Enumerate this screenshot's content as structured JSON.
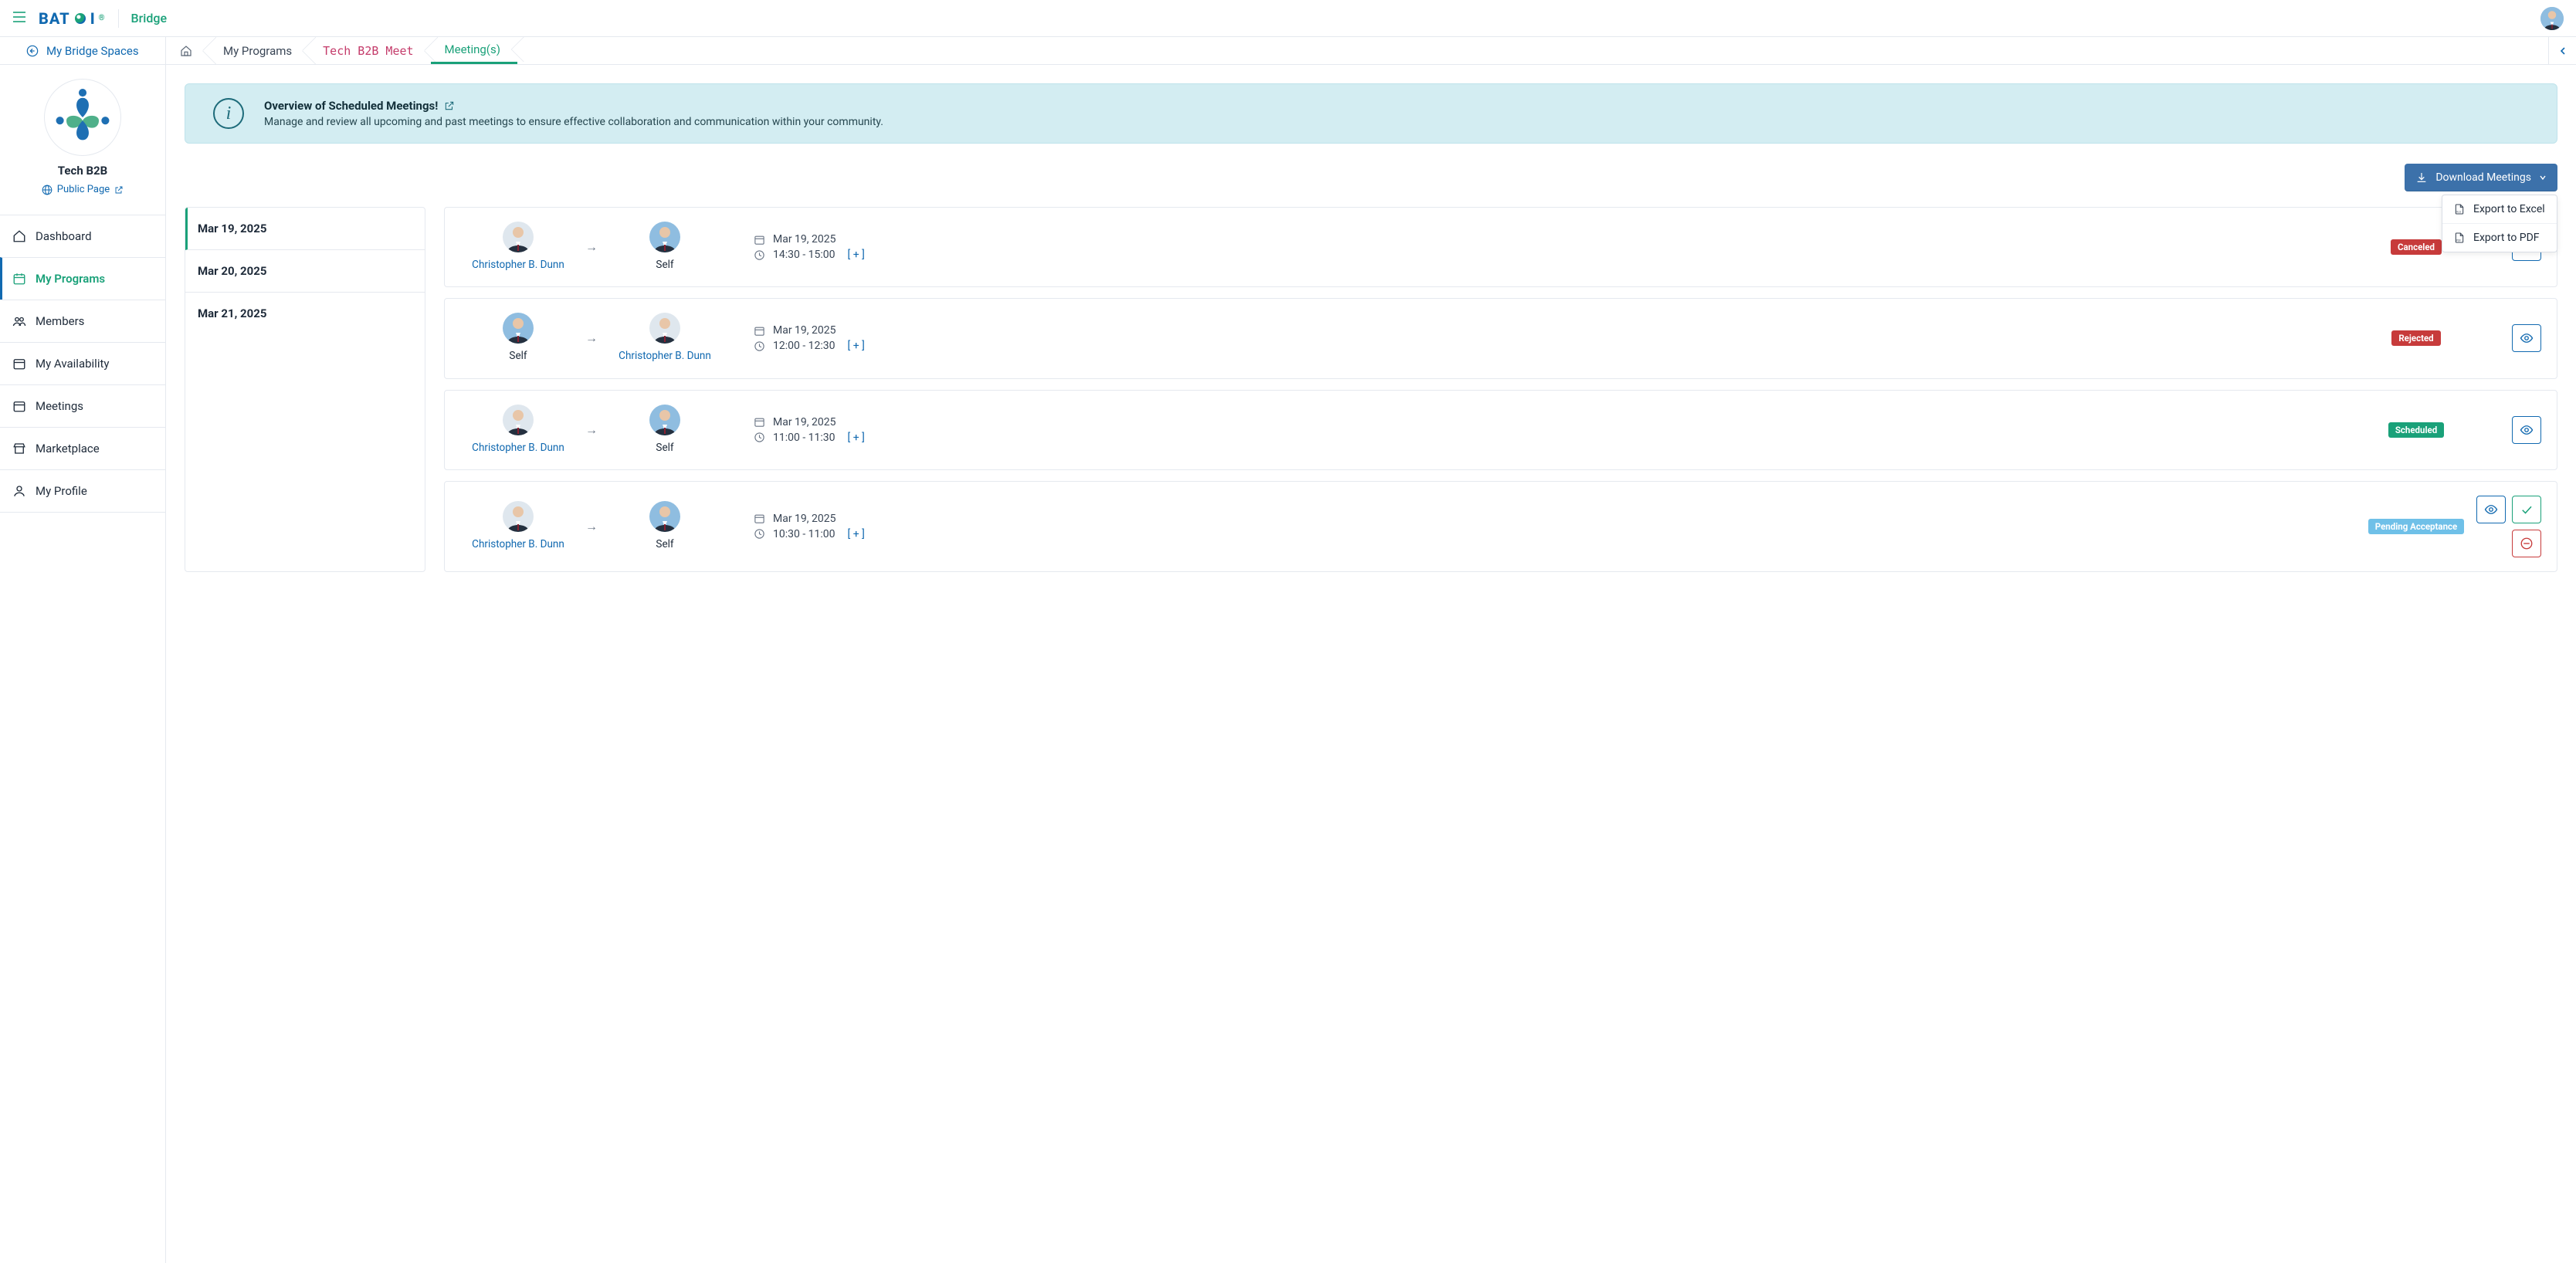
{
  "header": {
    "brand_left": "BAT",
    "brand_right": "I",
    "bridge_label": "Bridge"
  },
  "spaces_button": "My Bridge Spaces",
  "breadcrumbs": {
    "programs": "My Programs",
    "program_name": "Tech B2B Meet",
    "current": "Meeting(s)"
  },
  "org": {
    "name": "Tech B2B",
    "public_page": "Public Page"
  },
  "nav": {
    "dashboard": "Dashboard",
    "programs": "My Programs",
    "members": "Members",
    "availability": "My Availability",
    "meetings": "Meetings",
    "marketplace": "Marketplace",
    "profile": "My Profile"
  },
  "info": {
    "title": "Overview of Scheduled Meetings!",
    "subtitle": "Manage and review all upcoming and past meetings to ensure effective collaboration and communication within your community."
  },
  "download": {
    "button": "Download Meetings",
    "excel": "Export to Excel",
    "pdf": "Export to PDF"
  },
  "dates": {
    "d0": "Mar 19, 2025",
    "d1": "Mar 20, 2025",
    "d2": "Mar 21, 2025"
  },
  "labels": {
    "self": "Self",
    "plus": "[ + ]"
  },
  "people": {
    "cbd": "Christopher B. Dunn"
  },
  "status": {
    "canceled": "Canceled",
    "rejected": "Rejected",
    "scheduled": "Scheduled",
    "pending": "Pending Acceptance"
  },
  "meetings": [
    {
      "from": "cbd",
      "to": "self",
      "date": "Mar 19, 2025",
      "time": "14:30 - 15:00",
      "status": "canceled"
    },
    {
      "from": "self",
      "to": "cbd",
      "date": "Mar 19, 2025",
      "time": "12:00 - 12:30",
      "status": "rejected"
    },
    {
      "from": "cbd",
      "to": "self",
      "date": "Mar 19, 2025",
      "time": "11:00 - 11:30",
      "status": "scheduled"
    },
    {
      "from": "cbd",
      "to": "self",
      "date": "Mar 19, 2025",
      "time": "10:30 - 11:00",
      "status": "pending"
    }
  ],
  "m0": {
    "date": "Mar 19, 2025",
    "time": "14:30 - 15:00"
  },
  "m1": {
    "date": "Mar 19, 2025",
    "time": "12:00 - 12:30"
  },
  "m2": {
    "date": "Mar 19, 2025",
    "time": "11:00 - 11:30"
  },
  "m3": {
    "date": "Mar 19, 2025",
    "time": "10:30 - 11:00"
  }
}
